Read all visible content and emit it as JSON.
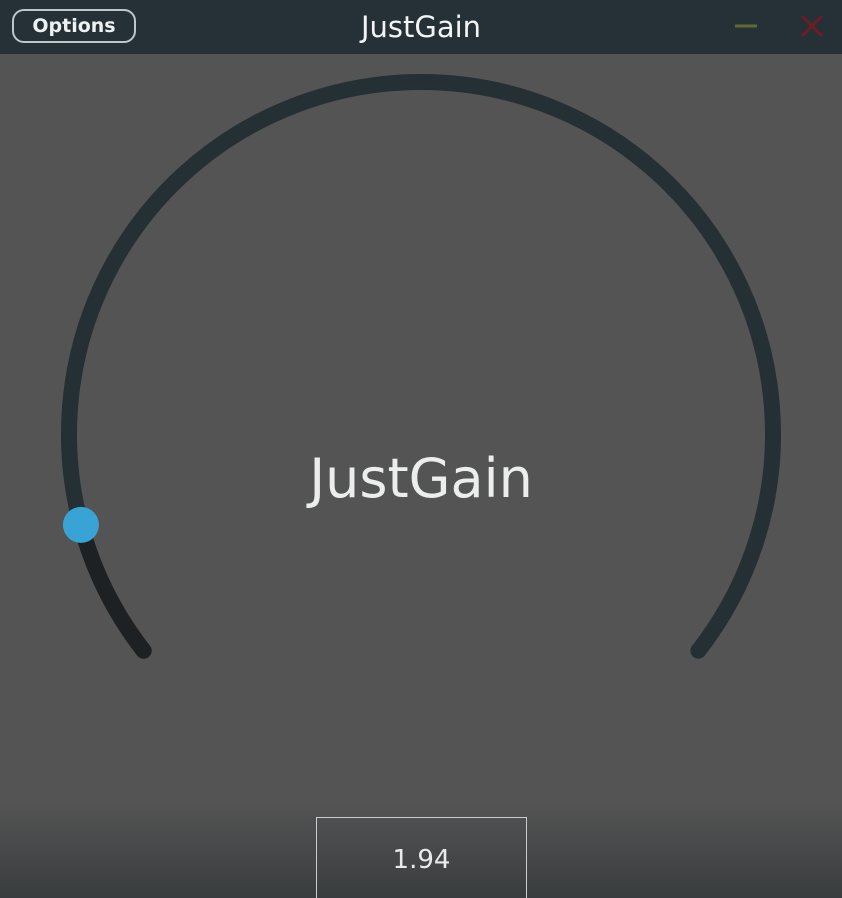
{
  "window": {
    "title": "JustGain",
    "options_label": "Options",
    "min_icon": "minimize-icon",
    "close_icon": "close-icon"
  },
  "knob": {
    "label": "JustGain",
    "value": "1.94",
    "position_fraction": 0.09
  },
  "colors": {
    "background": "#545454",
    "titlebar": "#253037",
    "track": "#253035",
    "filled_track": "#1d2124",
    "thumb": "#3aa3d5",
    "minimize": "#5f6b2e",
    "close": "#6e1d22"
  }
}
